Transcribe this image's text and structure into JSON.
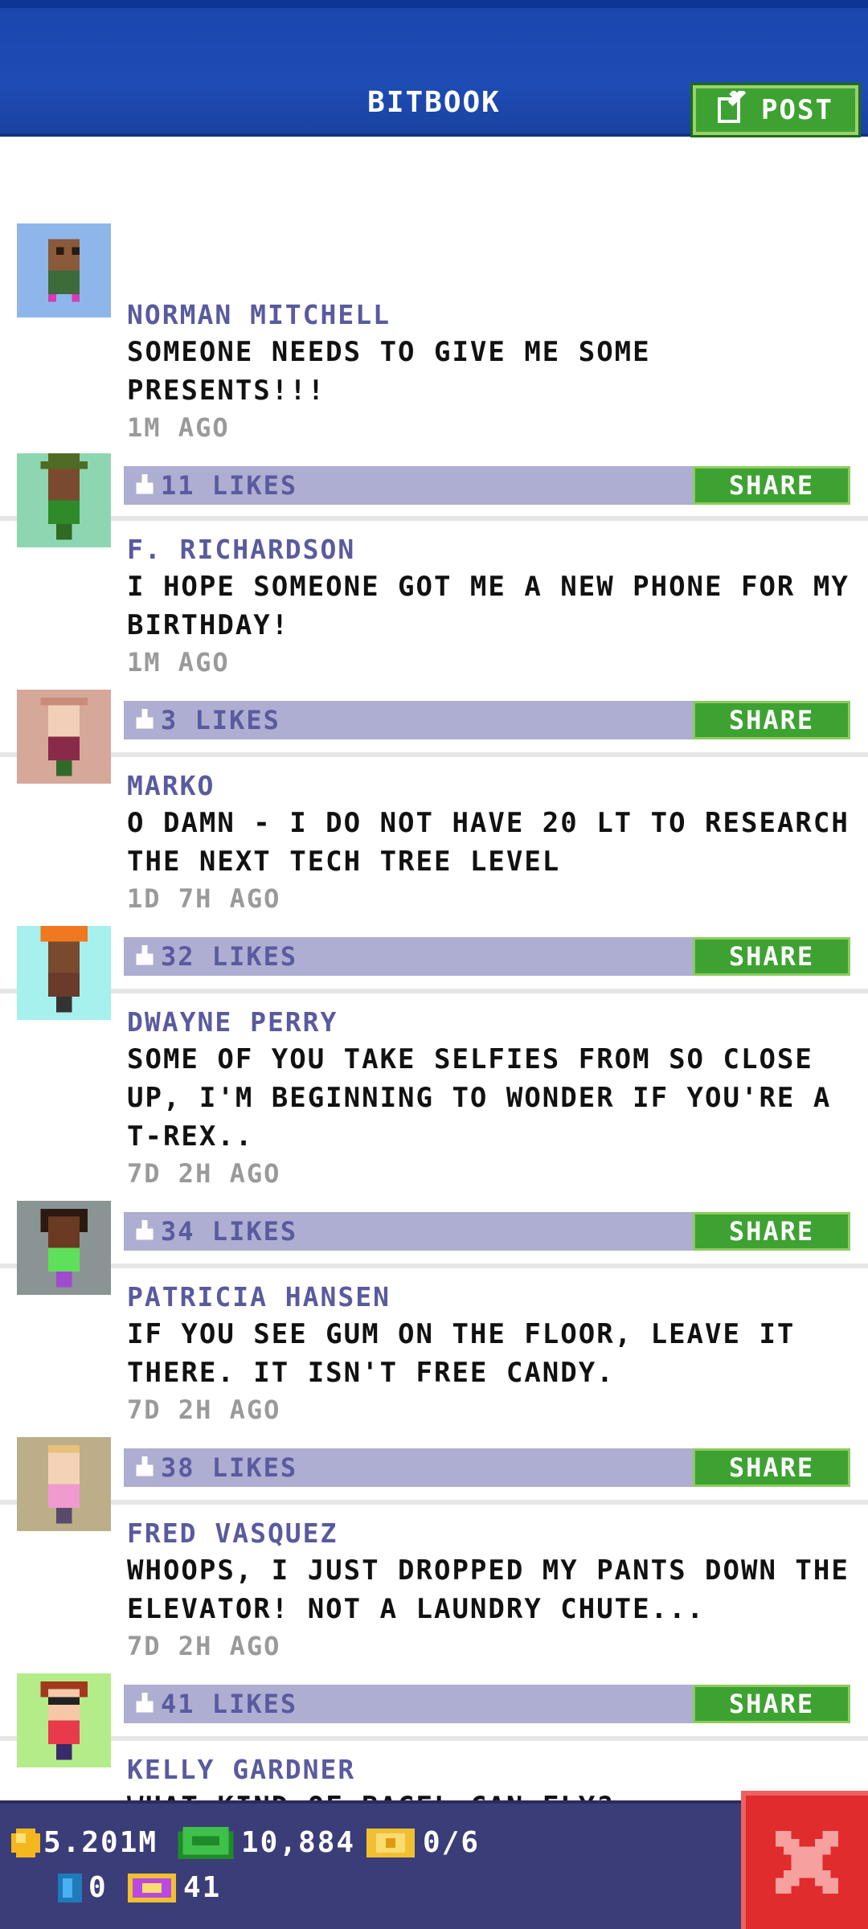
{
  "header": {
    "title": "BITBOOK",
    "post_label": "POST"
  },
  "posts": [
    {
      "name": "NORMAN MITCHELL",
      "message": "SOMEONE NEEDS TO GIVE ME SOME PRESENTS!!!",
      "time": "1M AGO",
      "likes": "11 LIKES",
      "share": "SHARE"
    },
    {
      "name": "F. RICHARDSON",
      "message": "I HOPE SOMEONE GOT ME A NEW PHONE FOR MY BIRTHDAY!",
      "time": "1M AGO",
      "likes": "3 LIKES",
      "share": "SHARE"
    },
    {
      "name": "MARKO",
      "message": "O DAMN - I DO NOT HAVE 20 LT TO RESEARCH THE NEXT TECH TREE LEVEL",
      "time": "1D 7H AGO",
      "likes": "32 LIKES",
      "share": "SHARE"
    },
    {
      "name": "DWAYNE PERRY",
      "message": "SOME OF YOU TAKE SELFIES FROM SO CLOSE UP, I'M BEGINNING TO WONDER IF YOU'RE A T-REX..",
      "time": "7D 2H AGO",
      "likes": "34 LIKES",
      "share": "SHARE"
    },
    {
      "name": "PATRICIA HANSEN",
      "message": "IF YOU SEE GUM ON THE FLOOR, LEAVE IT THERE. IT ISN'T FREE CANDY.",
      "time": "7D 2H AGO",
      "likes": "38 LIKES",
      "share": "SHARE"
    },
    {
      "name": "FRED VASQUEZ",
      "message": "WHOOPS, I JUST DROPPED MY PANTS DOWN THE ELEVATOR! NOT A LAUNDRY CHUTE...",
      "time": "7D 2H AGO",
      "likes": "41 LIKES",
      "share": "SHARE"
    },
    {
      "name": "KELLY GARDNER",
      "message": "WHAT KIND OF BAGEL CAN FLY?",
      "time": ""
    }
  ],
  "status": {
    "coins": "5.201M",
    "bux": "10,884",
    "tickets": "0/6",
    "keys": "0",
    "vip": "41"
  },
  "colors": {
    "header_blue": "#1e4cb4",
    "post_green": "#3da231",
    "name_purple": "#5a5a9e",
    "likebar": "#aeaed2",
    "bottom_bar": "#3b3d78",
    "close_red": "#e02c2c"
  }
}
